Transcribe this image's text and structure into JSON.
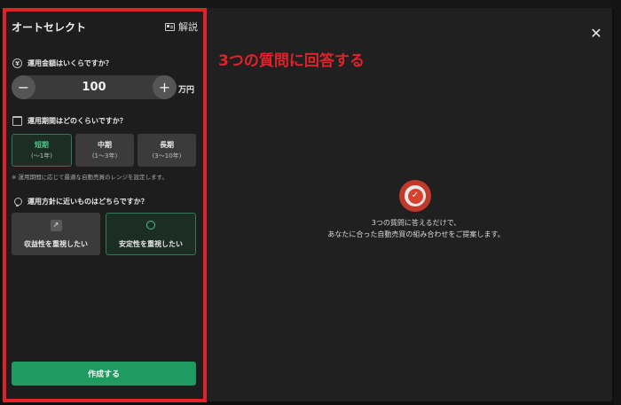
{
  "panel": {
    "title": "オートセレクト",
    "help_label": "解説"
  },
  "q1": {
    "label": "運用金額はいくらですか？",
    "icon": "yen-icon",
    "value": "100",
    "unit": "万円",
    "minus": "−",
    "plus": "+"
  },
  "q2": {
    "label": "運用期間はどのくらいですか？",
    "icon": "calendar-icon",
    "options": [
      {
        "label": "短期",
        "range": "(〜1年)",
        "selected": true
      },
      {
        "label": "中期",
        "range": "(1〜3年)",
        "selected": false
      },
      {
        "label": "長期",
        "range": "(3〜10年)",
        "selected": false
      }
    ],
    "note": "※ 運用期間に応じて最適な自動売買のレンジを設定します。"
  },
  "q3": {
    "label": "運用方針に近いものはどちらですか？",
    "icon": "lightbulb-icon",
    "options": [
      {
        "label": "収益性を重視したい",
        "icon": "trend-up-icon",
        "selected": false
      },
      {
        "label": "安定性を重視したい",
        "icon": "ring-icon",
        "selected": true
      }
    ]
  },
  "create_label": "作成する",
  "annotation": "3つの質問に回答する",
  "close_glyph": "✕",
  "center": {
    "icon": "check-badge-icon",
    "line1": "3つの質問に答えるだけで、",
    "line2": "あなたに合った自動売買の組み合わせをご提案します。"
  },
  "colors": {
    "accent_green": "#1f9a60",
    "highlight_red": "#e1222a",
    "background": "#202020"
  }
}
